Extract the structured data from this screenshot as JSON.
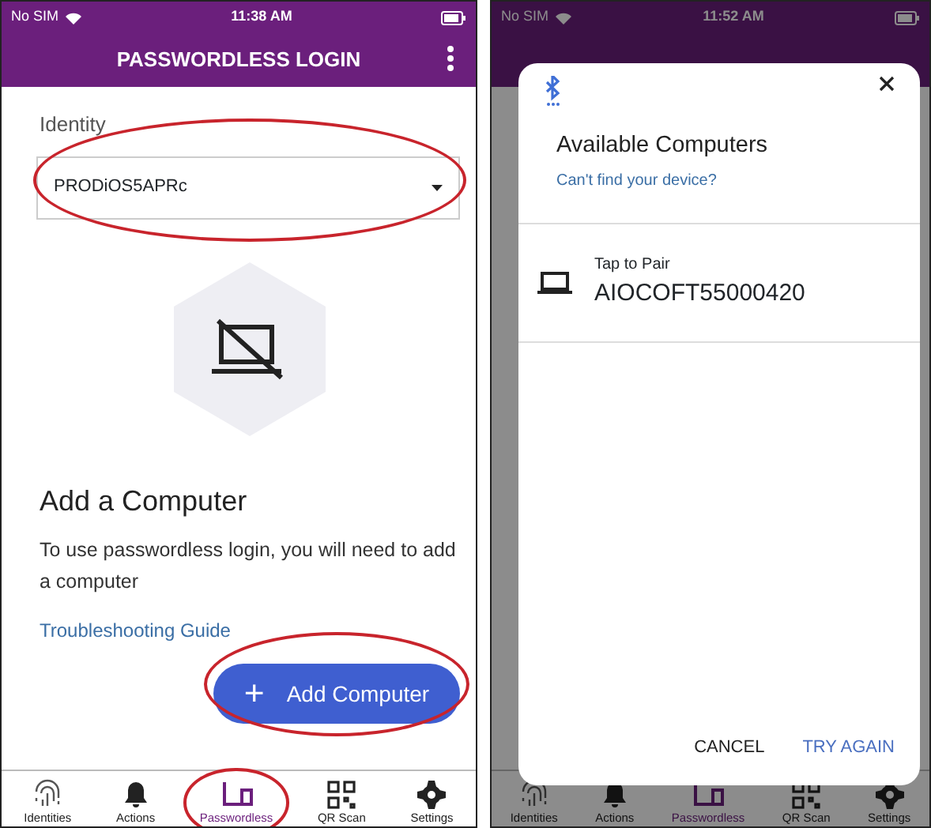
{
  "screens": [
    {
      "status_bar": {
        "carrier": "No SIM",
        "time": "11:38 AM"
      },
      "header": {
        "title": "PASSWORDLESS LOGIN"
      },
      "identity": {
        "label": "Identity",
        "value": "PRODiOS5APRc",
        "circled": true
      },
      "empty_state": {
        "title": "Add a Computer",
        "text": "To use passwordless login, you will need to add a computer",
        "link": "Troubleshooting Guide"
      },
      "add_button": {
        "icon": "+",
        "label": "Add Computer",
        "circled": true
      },
      "tabs": [
        {
          "label": "Identities",
          "selected": false,
          "circled": false
        },
        {
          "label": "Actions",
          "selected": false,
          "circled": false
        },
        {
          "label": "Passwordless",
          "selected": true,
          "circled": true
        },
        {
          "label": "QR Scan",
          "selected": false,
          "circled": false
        },
        {
          "label": "Settings",
          "selected": false,
          "circled": false
        }
      ]
    },
    {
      "status_bar": {
        "carrier": "No SIM",
        "time": "11:52 AM"
      },
      "dialog": {
        "title": "Available Computers",
        "subtitle": "Can't find your device?",
        "devices": [
          {
            "hint": "Tap to Pair",
            "name": "AIOCOFT55000420"
          }
        ],
        "buttons": [
          {
            "label": "CANCEL",
            "kind": "plain"
          },
          {
            "label": "TRY AGAIN",
            "kind": "primary"
          }
        ]
      },
      "tabs": [
        {
          "label": "Identities",
          "selected": false
        },
        {
          "label": "Actions",
          "selected": false
        },
        {
          "label": "Passwordless",
          "selected": true
        },
        {
          "label": "QR Scan",
          "selected": false
        },
        {
          "label": "Settings",
          "selected": false
        }
      ]
    }
  ]
}
